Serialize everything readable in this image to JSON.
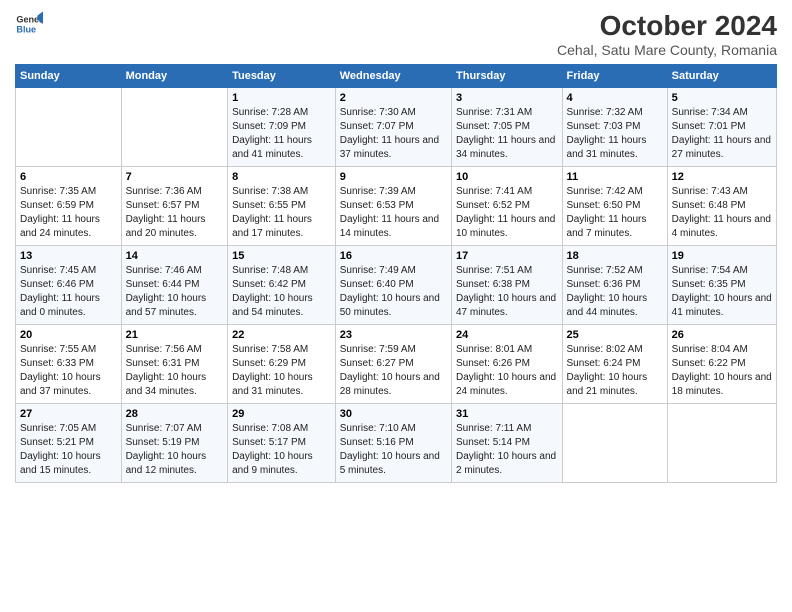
{
  "header": {
    "logo": {
      "line1": "General",
      "line2": "Blue"
    },
    "title": "October 2024",
    "subtitle": "Cehal, Satu Mare County, Romania"
  },
  "days_of_week": [
    "Sunday",
    "Monday",
    "Tuesday",
    "Wednesday",
    "Thursday",
    "Friday",
    "Saturday"
  ],
  "weeks": [
    {
      "cells": [
        {
          "day": null,
          "info": null
        },
        {
          "day": null,
          "info": null
        },
        {
          "day": "1",
          "info": "Sunrise: 7:28 AM\nSunset: 7:09 PM\nDaylight: 11 hours and 41 minutes."
        },
        {
          "day": "2",
          "info": "Sunrise: 7:30 AM\nSunset: 7:07 PM\nDaylight: 11 hours and 37 minutes."
        },
        {
          "day": "3",
          "info": "Sunrise: 7:31 AM\nSunset: 7:05 PM\nDaylight: 11 hours and 34 minutes."
        },
        {
          "day": "4",
          "info": "Sunrise: 7:32 AM\nSunset: 7:03 PM\nDaylight: 11 hours and 31 minutes."
        },
        {
          "day": "5",
          "info": "Sunrise: 7:34 AM\nSunset: 7:01 PM\nDaylight: 11 hours and 27 minutes."
        }
      ]
    },
    {
      "cells": [
        {
          "day": "6",
          "info": "Sunrise: 7:35 AM\nSunset: 6:59 PM\nDaylight: 11 hours and 24 minutes."
        },
        {
          "day": "7",
          "info": "Sunrise: 7:36 AM\nSunset: 6:57 PM\nDaylight: 11 hours and 20 minutes."
        },
        {
          "day": "8",
          "info": "Sunrise: 7:38 AM\nSunset: 6:55 PM\nDaylight: 11 hours and 17 minutes."
        },
        {
          "day": "9",
          "info": "Sunrise: 7:39 AM\nSunset: 6:53 PM\nDaylight: 11 hours and 14 minutes."
        },
        {
          "day": "10",
          "info": "Sunrise: 7:41 AM\nSunset: 6:52 PM\nDaylight: 11 hours and 10 minutes."
        },
        {
          "day": "11",
          "info": "Sunrise: 7:42 AM\nSunset: 6:50 PM\nDaylight: 11 hours and 7 minutes."
        },
        {
          "day": "12",
          "info": "Sunrise: 7:43 AM\nSunset: 6:48 PM\nDaylight: 11 hours and 4 minutes."
        }
      ]
    },
    {
      "cells": [
        {
          "day": "13",
          "info": "Sunrise: 7:45 AM\nSunset: 6:46 PM\nDaylight: 11 hours and 0 minutes."
        },
        {
          "day": "14",
          "info": "Sunrise: 7:46 AM\nSunset: 6:44 PM\nDaylight: 10 hours and 57 minutes."
        },
        {
          "day": "15",
          "info": "Sunrise: 7:48 AM\nSunset: 6:42 PM\nDaylight: 10 hours and 54 minutes."
        },
        {
          "day": "16",
          "info": "Sunrise: 7:49 AM\nSunset: 6:40 PM\nDaylight: 10 hours and 50 minutes."
        },
        {
          "day": "17",
          "info": "Sunrise: 7:51 AM\nSunset: 6:38 PM\nDaylight: 10 hours and 47 minutes."
        },
        {
          "day": "18",
          "info": "Sunrise: 7:52 AM\nSunset: 6:36 PM\nDaylight: 10 hours and 44 minutes."
        },
        {
          "day": "19",
          "info": "Sunrise: 7:54 AM\nSunset: 6:35 PM\nDaylight: 10 hours and 41 minutes."
        }
      ]
    },
    {
      "cells": [
        {
          "day": "20",
          "info": "Sunrise: 7:55 AM\nSunset: 6:33 PM\nDaylight: 10 hours and 37 minutes."
        },
        {
          "day": "21",
          "info": "Sunrise: 7:56 AM\nSunset: 6:31 PM\nDaylight: 10 hours and 34 minutes."
        },
        {
          "day": "22",
          "info": "Sunrise: 7:58 AM\nSunset: 6:29 PM\nDaylight: 10 hours and 31 minutes."
        },
        {
          "day": "23",
          "info": "Sunrise: 7:59 AM\nSunset: 6:27 PM\nDaylight: 10 hours and 28 minutes."
        },
        {
          "day": "24",
          "info": "Sunrise: 8:01 AM\nSunset: 6:26 PM\nDaylight: 10 hours and 24 minutes."
        },
        {
          "day": "25",
          "info": "Sunrise: 8:02 AM\nSunset: 6:24 PM\nDaylight: 10 hours and 21 minutes."
        },
        {
          "day": "26",
          "info": "Sunrise: 8:04 AM\nSunset: 6:22 PM\nDaylight: 10 hours and 18 minutes."
        }
      ]
    },
    {
      "cells": [
        {
          "day": "27",
          "info": "Sunrise: 7:05 AM\nSunset: 5:21 PM\nDaylight: 10 hours and 15 minutes."
        },
        {
          "day": "28",
          "info": "Sunrise: 7:07 AM\nSunset: 5:19 PM\nDaylight: 10 hours and 12 minutes."
        },
        {
          "day": "29",
          "info": "Sunrise: 7:08 AM\nSunset: 5:17 PM\nDaylight: 10 hours and 9 minutes."
        },
        {
          "day": "30",
          "info": "Sunrise: 7:10 AM\nSunset: 5:16 PM\nDaylight: 10 hours and 5 minutes."
        },
        {
          "day": "31",
          "info": "Sunrise: 7:11 AM\nSunset: 5:14 PM\nDaylight: 10 hours and 2 minutes."
        },
        {
          "day": null,
          "info": null
        },
        {
          "day": null,
          "info": null
        }
      ]
    }
  ]
}
